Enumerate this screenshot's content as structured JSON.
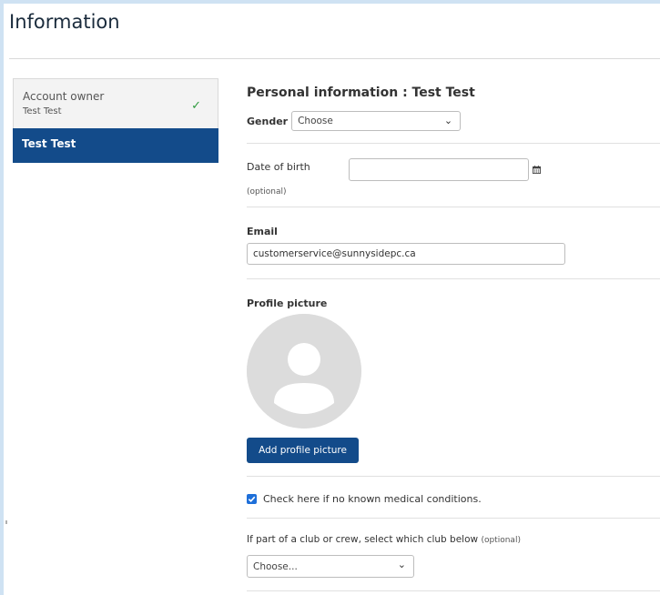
{
  "header": {
    "title": "Information"
  },
  "sidebar": {
    "owner_label": "Account owner",
    "owner_name": "Test Test",
    "active_member": "Test Test"
  },
  "personal": {
    "heading": "Personal information : Test Test",
    "gender_label": "Gender",
    "gender_value": "Choose"
  },
  "dob": {
    "label": "Date of birth",
    "optional": "(optional)",
    "value": ""
  },
  "email": {
    "label": "Email",
    "value": "customerservice@sunnysidepc.ca"
  },
  "profile": {
    "label": "Profile picture",
    "button": "Add profile picture"
  },
  "medical": {
    "checked": true,
    "label": "Check here if no known medical conditions."
  },
  "club": {
    "label": "If part of a club or crew, select which club below",
    "optional": "(optional)",
    "value": "Choose..."
  },
  "colors": {
    "primary": "#134b8a",
    "checkmark": "#2e9a3e",
    "checkbox": "#1e6fd9",
    "page_bg": "#cfe2f3"
  },
  "icons": {
    "check": "check-icon",
    "chevron": "chevron-down-icon",
    "calendar": "calendar-icon",
    "avatar": "avatar-placeholder-icon",
    "checkbox": "checkbox-icon"
  }
}
